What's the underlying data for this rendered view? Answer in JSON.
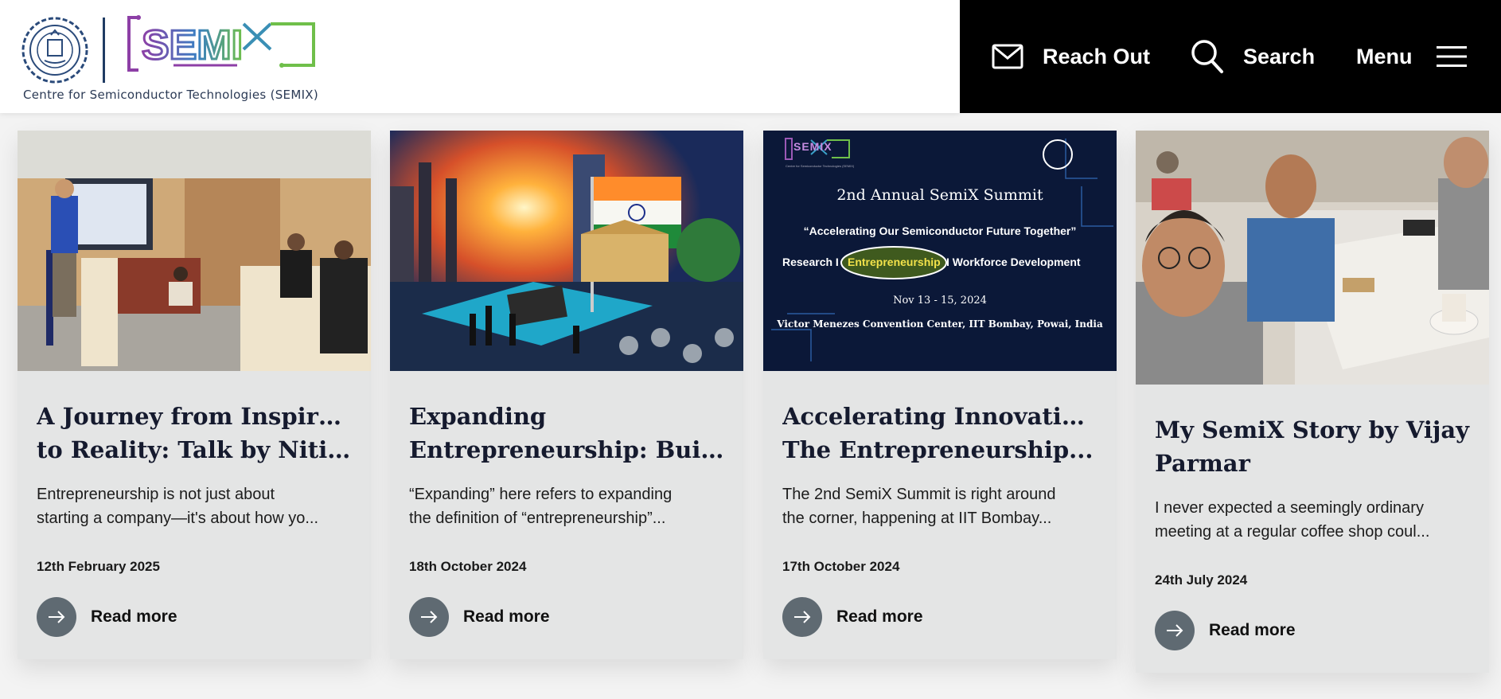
{
  "header": {
    "logo_caption": "Centre for Semiconductor Technologies (SEMIX)",
    "logo_text": "SEMIX",
    "nav": {
      "reach_out": "Reach Out",
      "search": "Search",
      "menu": "Menu"
    }
  },
  "cards": [
    {
      "title_line1": "A Journey from Inspiration",
      "title_line2": "to Reality: Talk by Nitin...",
      "excerpt_line1": "Entrepreneurship is not just about",
      "excerpt_line2": "starting a company—it's about how yo...",
      "date": "12th February 2025",
      "read_more": "Read more"
    },
    {
      "title_line1": "Expanding",
      "title_line2": "Entrepreneurship: Buildi...",
      "excerpt_line1": "“Expanding” here refers to expanding",
      "excerpt_line2": "the definition of “entrepreneurship”...",
      "date": "18th October 2024",
      "read_more": "Read more"
    },
    {
      "title_line1": "Accelerating Innovation:",
      "title_line2": "The Entrepreneurship...",
      "excerpt_line1": "The 2nd SemiX Summit is right around",
      "excerpt_line2": "the corner, happening at IIT Bombay...",
      "date": "17th October 2024",
      "read_more": "Read more",
      "poster": {
        "logo": "SEMIX",
        "logo_sub": "Centre for Semiconductor Technologies (SEMIX)",
        "title": "2nd Annual SemiX Summit",
        "tagline": "“Accelerating  Our Semiconductor Future Together”",
        "pillar_left": "Research  I",
        "pillar_mid": "Entrepreneurship",
        "pillar_right": "I  Workforce Development",
        "dates": "Nov 13 - 15, 2024",
        "venue": "Victor Menezes Convention Center,  IIT Bombay, Powai, India"
      }
    },
    {
      "title_line1": "My SemiX Story by Vijay",
      "title_line2": "Parmar",
      "excerpt_line1": "I never expected a seemingly ordinary",
      "excerpt_line2": "meeting at a regular coffee shop coul...",
      "date": "24th July 2024",
      "read_more": "Read more"
    }
  ],
  "colors": {
    "header_dark": "#000000",
    "card_bg": "#e4e5e5",
    "arrow_button": "#5f6a72",
    "title_text": "#151a2e"
  }
}
